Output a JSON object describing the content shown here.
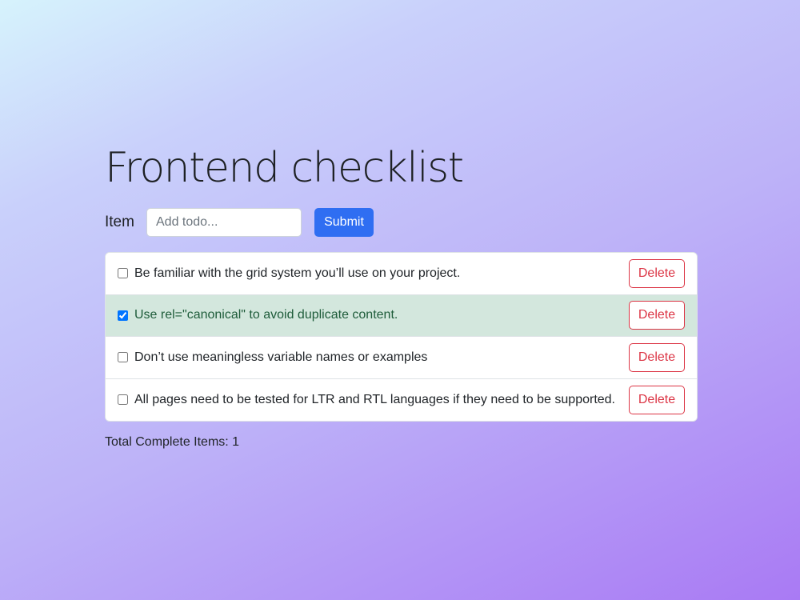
{
  "title": "Frontend checklist",
  "form": {
    "label": "Item",
    "placeholder": "Add todo...",
    "value": "",
    "submit_label": "Submit"
  },
  "todos": [
    {
      "text": "Be familiar with the grid system you’ll use on your project.",
      "checked": false,
      "delete_label": "Delete"
    },
    {
      "text": "Use rel=\"canonical\" to avoid duplicate content.",
      "checked": true,
      "delete_label": "Delete"
    },
    {
      "text": "Don’t use meaningless variable names or examples",
      "checked": false,
      "delete_label": "Delete"
    },
    {
      "text": "All pages need to be tested for LTR and RTL languages if they need to be supported.",
      "checked": false,
      "delete_label": "Delete"
    }
  ],
  "footer": {
    "label": "Total Complete Items: ",
    "count": "1"
  },
  "colors": {
    "accent": "#2f6ef2",
    "danger": "#dc3545",
    "done_row": "#d3e7dd",
    "done_text": "#1e5c3a"
  }
}
